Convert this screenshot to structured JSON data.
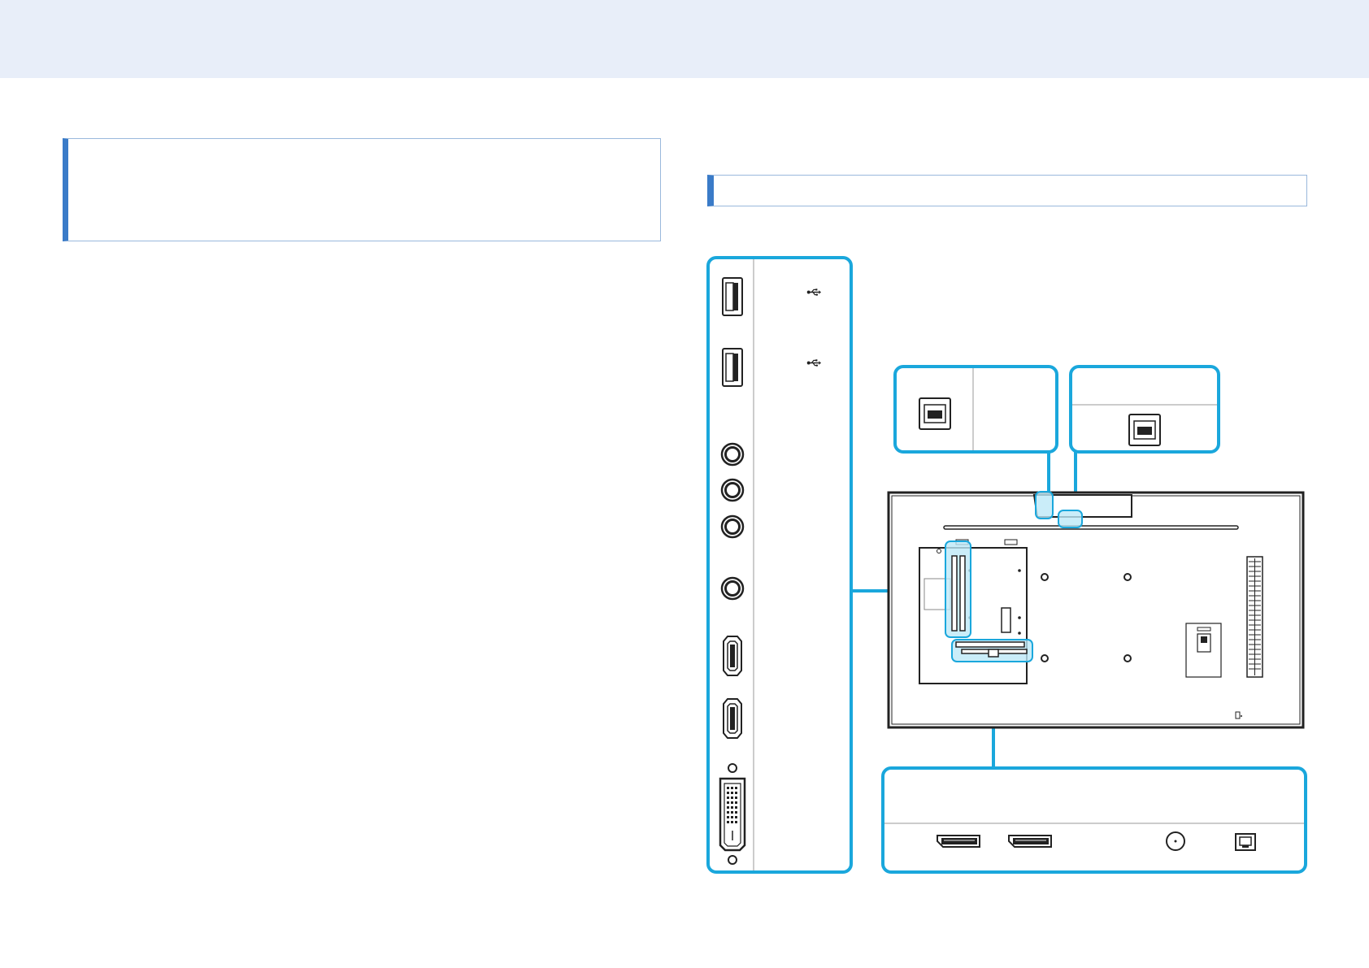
{
  "colors": {
    "header_band": "#e8eef9",
    "accent": "#3a7bc8",
    "callout": "#1aa7dc",
    "highlight_fill": "#bde9f7",
    "line": "#222222"
  },
  "icons": [
    "usb-icon"
  ]
}
